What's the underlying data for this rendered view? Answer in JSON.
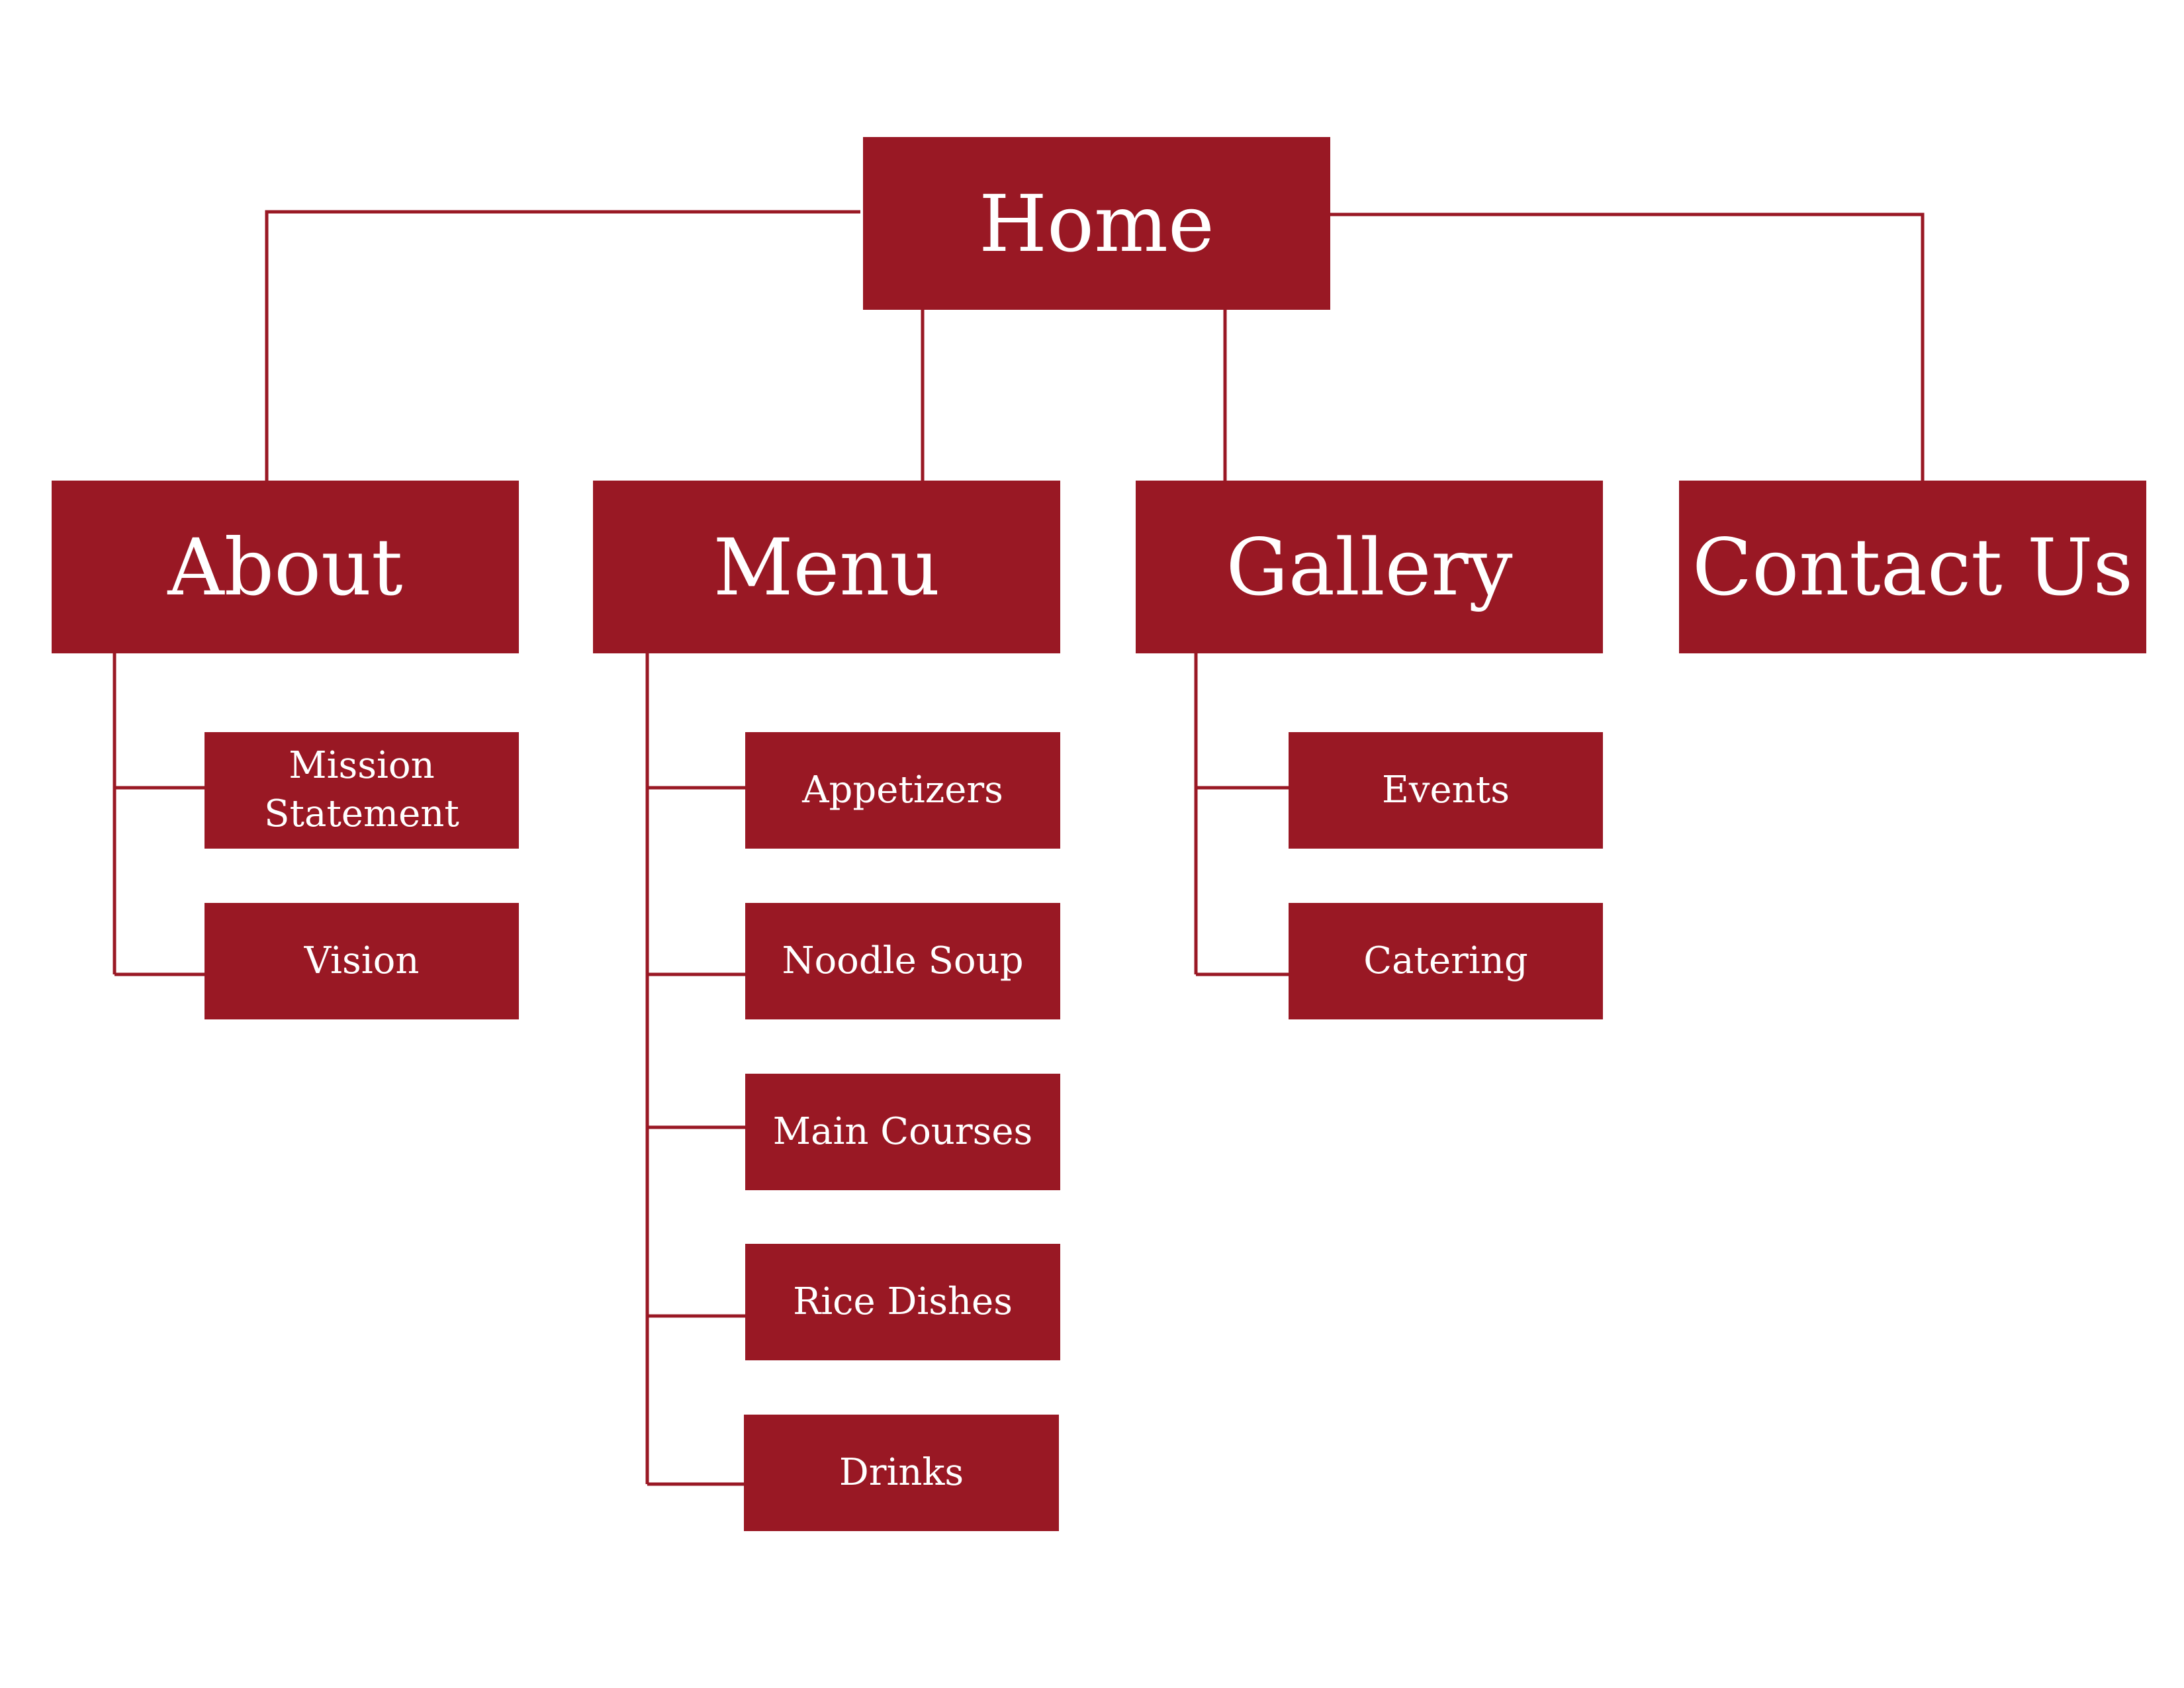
{
  "colors": {
    "box_fill": "#991824",
    "connector": "#991824",
    "text": "#ffffff",
    "background": "#ffffff"
  },
  "sitemap": {
    "root": {
      "label": "Home"
    },
    "sections": [
      {
        "label": "About",
        "children": [
          "Mission\nStatement",
          "Vision"
        ]
      },
      {
        "label": "Menu",
        "children": [
          "Appetizers",
          "Noodle Soup",
          "Main Courses",
          "Rice Dishes",
          "Drinks"
        ]
      },
      {
        "label": "Gallery",
        "children": [
          "Events",
          "Catering"
        ]
      },
      {
        "label": "Contact Us",
        "children": []
      }
    ]
  }
}
